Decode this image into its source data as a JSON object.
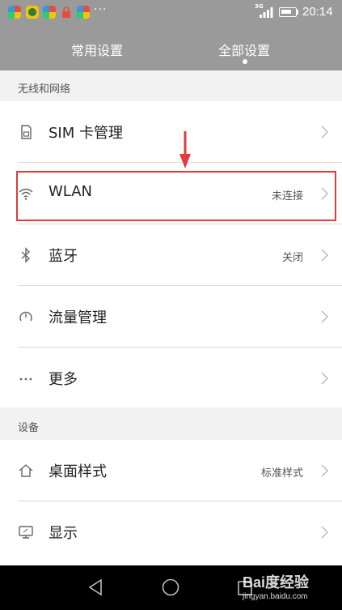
{
  "status_bar": {
    "overflow_indicator": "···",
    "network": "3G",
    "time": "20:14",
    "app_icons": [
      "app-icon-1",
      "app-icon-2",
      "app-icon-3",
      "lock-app-icon",
      "app-icon-4"
    ]
  },
  "tabs": [
    {
      "label": "常用设置",
      "active": false
    },
    {
      "label": "全部设置",
      "active": true
    }
  ],
  "sections": [
    {
      "title": "无线和网络",
      "items": [
        {
          "label": "SIM 卡管理",
          "value": "",
          "icon": "sim-card-icon"
        },
        {
          "label": "WLAN",
          "value": "未连接",
          "icon": "wifi-icon"
        },
        {
          "label": "蓝牙",
          "value": "关闭",
          "icon": "bluetooth-icon"
        },
        {
          "label": "流量管理",
          "value": "",
          "icon": "data-usage-icon"
        },
        {
          "label": "更多",
          "value": "",
          "icon": "more-icon"
        }
      ]
    },
    {
      "title": "设备",
      "items": [
        {
          "label": "桌面样式",
          "value": "标准样式",
          "icon": "home-icon"
        },
        {
          "label": "显示",
          "value": "",
          "icon": "display-icon"
        }
      ]
    }
  ],
  "watermark": {
    "main": "Bai度经验",
    "sub": "jingyan.baidu.com"
  },
  "colors": {
    "header": "#9a9a9a",
    "highlight": "#e23b3b",
    "background": "#f2f2f2"
  }
}
